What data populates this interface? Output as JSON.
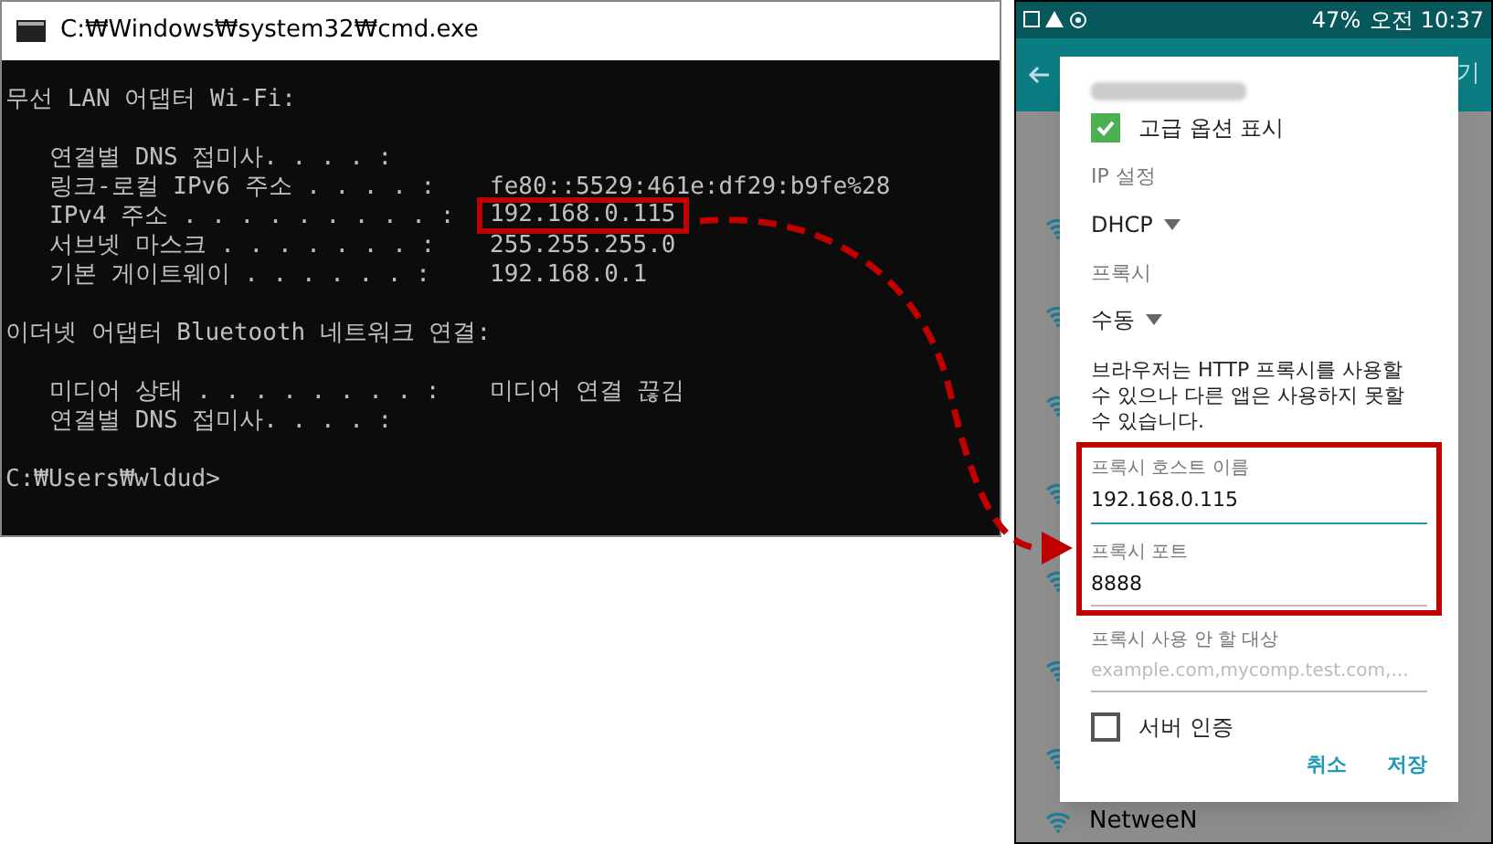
{
  "console_window": {
    "title": "C:₩Windows₩system32₩cmd.exe",
    "lines": [
      {
        "kind": "heading",
        "text": "무선 LAN 어댑터 Wi-Fi:"
      },
      {
        "kind": "blank"
      },
      {
        "kind": "entry",
        "label": "연결별 DNS 접미사. . . . :"
      },
      {
        "kind": "entry",
        "label": "링크-로컬 IPv6 주소 . . . . :",
        "value": "fe80::5529:461e:df29:b9fe%28",
        "highlighted": false
      },
      {
        "kind": "entry",
        "label": "IPv4 주소 . . . . . . . . . :",
        "value": "192.168.0.115",
        "highlighted": true
      },
      {
        "kind": "entry",
        "label": "서브넷 마스크 . . . . . . . :",
        "value": "255.255.255.0",
        "highlighted": false
      },
      {
        "kind": "entry",
        "label": "기본 게이트웨이 . . . . . . :",
        "value": "192.168.0.1",
        "highlighted": false
      },
      {
        "kind": "blank"
      },
      {
        "kind": "heading",
        "text": "이더넷 어댑터 Bluetooth 네트워크 연결:"
      },
      {
        "kind": "blank"
      },
      {
        "kind": "entry",
        "label": "미디어 상태 . . . . . . . . :",
        "value": "미디어 연결 끊김",
        "highlighted": false
      },
      {
        "kind": "entry",
        "label": "연결별 DNS 접미사. . . . :"
      },
      {
        "kind": "blank"
      },
      {
        "kind": "prompt",
        "text": "C:₩Users₩wldud>"
      }
    ]
  },
  "phone": {
    "status_bar": {
      "battery": "47%",
      "time": "오전 10:37"
    },
    "app_bar": {
      "action": "기"
    },
    "background_list": {
      "last_item": "NetweeN"
    },
    "dialog": {
      "show_advanced": {
        "label": "고급 옵션 표시",
        "checked": true
      },
      "ip_settings": {
        "label": "IP 설정",
        "value": "DHCP"
      },
      "proxy": {
        "label": "프록시",
        "value": "수동"
      },
      "note": "브라우저는 HTTP 프록시를 사용할 수 있으나 다른 앱은 사용하지 못할 수 있습니다.",
      "fields": [
        {
          "label": "프록시 호스트 이름",
          "value": "192.168.0.115",
          "focused": true,
          "highlighted": true
        },
        {
          "label": "프록시 포트",
          "value": "8888",
          "focused": false,
          "highlighted": true
        },
        {
          "label": "프록시 사용 안 할 대상",
          "placeholder": "example.com,mycomp.test.com,...",
          "focused": false,
          "highlighted": false
        }
      ],
      "server_auth": {
        "label": "서버 인증",
        "checked": false
      },
      "buttons": [
        "취소",
        "저장"
      ]
    }
  }
}
